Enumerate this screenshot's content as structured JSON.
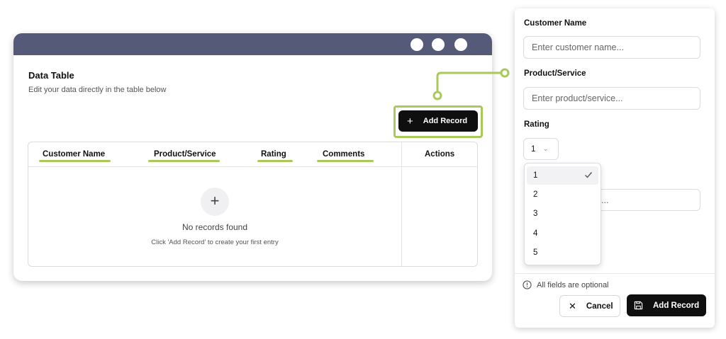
{
  "table_window": {
    "title": "Data Table",
    "subtitle": "Edit your data directly in the table below",
    "add_button_label": "Add Record",
    "columns": [
      "Customer Name",
      "Product/Service",
      "Rating",
      "Comments",
      "Actions"
    ],
    "empty_state": {
      "title": "No records found",
      "hint": "Click 'Add Record' to create your first entry"
    }
  },
  "form": {
    "customer_label": "Customer Name",
    "customer_placeholder": "Enter customer name...",
    "product_label": "Product/Service",
    "product_placeholder": "Enter product/service...",
    "rating_label": "Rating",
    "rating_value": "1",
    "rating_options": [
      "1",
      "2",
      "3",
      "4",
      "5"
    ],
    "comments_partial": "...",
    "note": "All fields are optional",
    "cancel_label": "Cancel",
    "submit_label": "Add Record"
  },
  "colors": {
    "titlebar": "#555a79",
    "highlight": "#a9c95a",
    "primary_button": "#0f0f10"
  }
}
